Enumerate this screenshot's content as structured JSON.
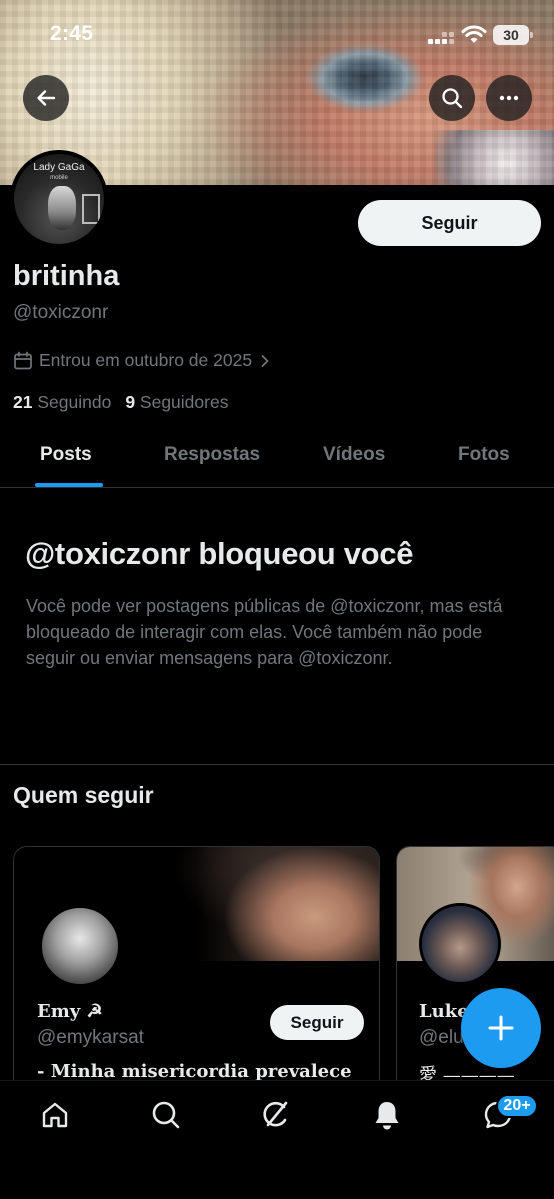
{
  "status_bar": {
    "time": "2:45",
    "battery": "30"
  },
  "profile": {
    "avatar_text": "Lady GaGa",
    "avatar_subtext": "mobile",
    "follow_label": "Seguir",
    "name": "britinha",
    "handle": "@toxiczonr",
    "joined": "Entrou em outubro de 2025",
    "following_count": "21",
    "following_label": "Seguindo",
    "followers_count": "9",
    "followers_label": "Seguidores"
  },
  "tabs": [
    {
      "label": "Posts",
      "active": true
    },
    {
      "label": "Respostas",
      "active": false
    },
    {
      "label": "Vídeos",
      "active": false
    },
    {
      "label": "Fotos",
      "active": false
    }
  ],
  "blocked": {
    "title": "@toxiczonr bloqueou você",
    "message": "Você pode ver postagens públicas de @toxiczonr, mas está bloqueado de interagir com elas. Você também não pode seguir ou enviar mensagens para @toxiczonr."
  },
  "who_to_follow": {
    "title": "Quem seguir",
    "cards": [
      {
        "name": "Emy ☭",
        "handle": "@emykarsat",
        "follow_label": "Seguir",
        "bio": "- Minha misericordia prevalece"
      },
      {
        "name": "Luke",
        "handle": "@elu",
        "bio": "愛 ————"
      }
    ]
  },
  "notifications_badge": "20+",
  "colors": {
    "accent": "#1d9bf0",
    "background": "#000000",
    "muted_text": "#71767b",
    "primary_text": "#e7e9ea"
  },
  "icons": [
    "back-arrow-icon",
    "search-icon",
    "more-icon",
    "calendar-icon",
    "chevron-right-icon",
    "plus-icon",
    "home-icon",
    "grok-icon",
    "bell-icon",
    "messages-icon"
  ]
}
